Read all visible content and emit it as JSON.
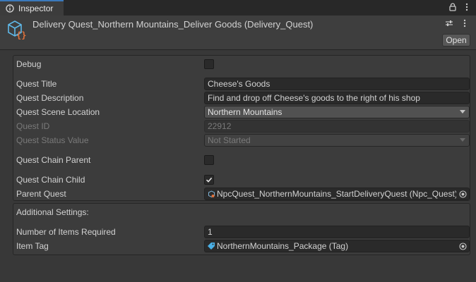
{
  "tab": {
    "label": "Inspector"
  },
  "header": {
    "title": "Delivery Quest_Northern Mountains_Deliver Goods (Delivery_Quest)",
    "open_label": "Open"
  },
  "fields": {
    "debug": {
      "label": "Debug",
      "checked": false
    },
    "quest_title": {
      "label": "Quest Title",
      "value": "Cheese's Goods"
    },
    "quest_description": {
      "label": "Quest Description",
      "value": "Find and drop off Cheese's goods to the right of his shop"
    },
    "quest_scene_location": {
      "label": "Quest Scene Location",
      "value": "Northern Mountains"
    },
    "quest_id": {
      "label": "Quest ID",
      "value": "22912"
    },
    "quest_status_value": {
      "label": "Quest Status Value",
      "value": "Not Started"
    },
    "quest_chain_parent": {
      "label": "Quest Chain Parent",
      "checked": false
    },
    "quest_chain_child": {
      "label": "Quest Chain Child",
      "checked": true
    },
    "parent_quest": {
      "label": "Parent Quest",
      "value": "NpcQuest_NorthernMountains_StartDeliveryQuest (Npc_Quest)"
    }
  },
  "additional": {
    "title": "Additional Settings:",
    "items_required": {
      "label": "Number of Items Required",
      "value": "1"
    },
    "item_tag": {
      "label": "Item Tag",
      "value": "NorthernMountains_Package (Tag)"
    }
  },
  "colors": {
    "accent_tab": "#3a79bb",
    "script_icon": "#5fb8e8",
    "script_brace": "#e0713a",
    "tag_icon": "#4ab0e6"
  },
  "icons": {
    "tab": "inspector-icon",
    "header": "scriptable-object-icon",
    "lock": "lock-icon",
    "menu": "kebab-menu-icon",
    "settings": "sliders-icon",
    "more": "vertical-dots-icon",
    "picker": "object-picker-icon",
    "tag": "tag-icon",
    "checkmark": "checkmark-icon"
  }
}
